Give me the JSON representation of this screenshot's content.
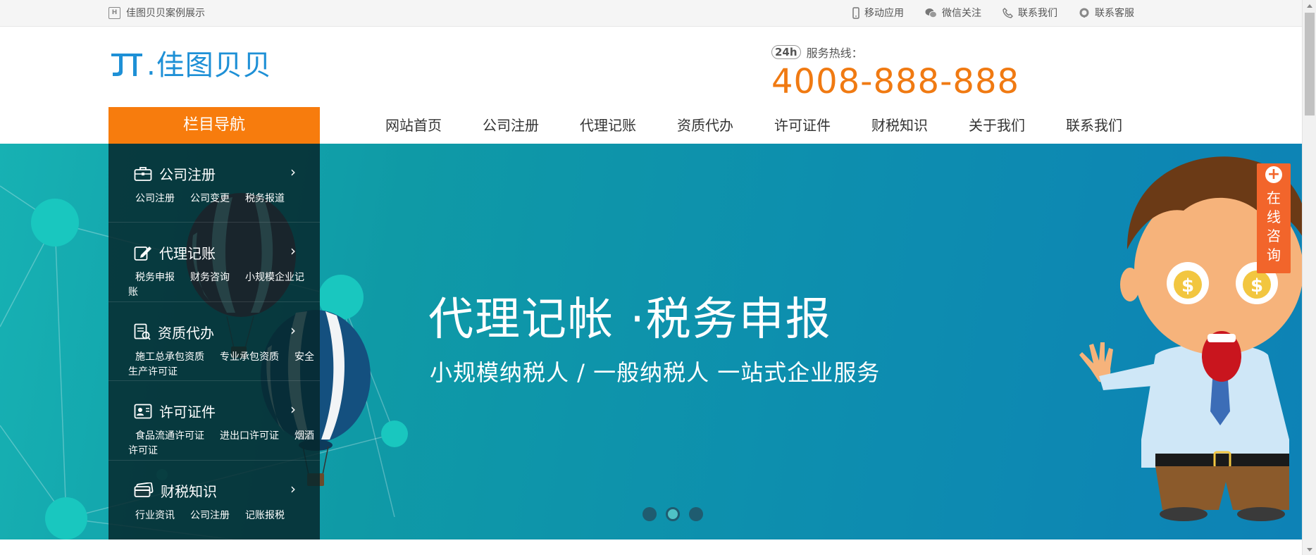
{
  "topbar": {
    "left_label": "佳图贝贝案例展示",
    "links": [
      {
        "label": "移动应用",
        "icon": "mobile-icon"
      },
      {
        "label": "微信关注",
        "icon": "wechat-icon"
      },
      {
        "label": "联系我们",
        "icon": "phone-icon"
      },
      {
        "label": "联系客服",
        "icon": "headset-icon"
      }
    ]
  },
  "header": {
    "logo_text": ".佳图贝贝",
    "hotline_label": "服务热线：",
    "hotline_badge": "24h",
    "hotline_number": "4008-888-888"
  },
  "nav": {
    "column_title": "栏目导航",
    "items": [
      "网站首页",
      "公司注册",
      "代理记账",
      "资质代办",
      "许可证件",
      "财税知识",
      "关于我们",
      "联系我们"
    ]
  },
  "sidebar": {
    "categories": [
      {
        "title": "公司注册",
        "icon": "briefcase-icon",
        "links": [
          "公司注册",
          "公司变更",
          "税务报道"
        ]
      },
      {
        "title": "代理记账",
        "icon": "edit-icon",
        "links": [
          "税务申报",
          "财务咨询",
          "小规模企业记账"
        ]
      },
      {
        "title": "资质代办",
        "icon": "document-icon",
        "links": [
          "施工总承包资质",
          "专业承包资质",
          "安全生产许可证"
        ]
      },
      {
        "title": "许可证件",
        "icon": "id-card-icon",
        "links": [
          "食品流通许可证",
          "进出口许可证",
          "烟酒许可证"
        ]
      },
      {
        "title": "财税知识",
        "icon": "card-icon",
        "links": [
          "行业资讯",
          "公司注册",
          "记账报税"
        ]
      }
    ]
  },
  "banner": {
    "title": "代理记帐 ·税务申报",
    "subtitle": "小规模纳税人 / 一般纳税人  一站式企业服务",
    "slide_count": 3,
    "active_slide": 2
  },
  "consult": {
    "label": "在线咨询",
    "chars": [
      "在",
      "线",
      "咨",
      "询"
    ]
  },
  "colors": {
    "accent_orange": "#f77c0d",
    "logo_blue": "#1e90d6",
    "hotline_orange": "#f07a12",
    "banner_teal": "#0f9aa6",
    "consult_orange": "#f2652b"
  }
}
